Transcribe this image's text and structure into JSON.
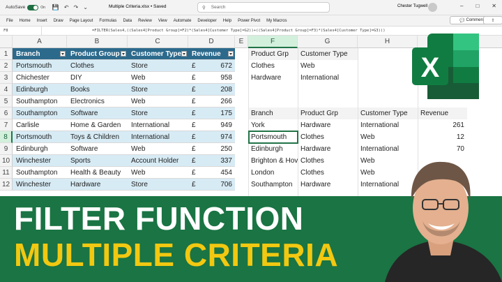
{
  "titlebar": {
    "autosave_label": "AutoSave",
    "toggle_state": "On",
    "doc_title": "Multiple Criteria.xlsx • Saved",
    "search_placeholder": "Search",
    "user_name": "Chester Tugwell"
  },
  "ribbon": {
    "tabs": [
      "File",
      "Home",
      "Insert",
      "Draw",
      "Page Layout",
      "Formulas",
      "Data",
      "Review",
      "View",
      "Automate",
      "Developer",
      "Help",
      "Power Pivot",
      "My Macros"
    ],
    "comments_label": "Comments",
    "share_icon": "share-icon"
  },
  "formula_bar": {
    "name_box": "F8",
    "formula": "=FILTER(Sales4,((Sales4[Product Group]=F2)*(Sales4[Customer Type]=G2))+((Sales4[Product Group]=F3)*(Sales4[Customer Type]=G3)))"
  },
  "columns": [
    "A",
    "B",
    "C",
    "D",
    "E",
    "F",
    "G",
    "H"
  ],
  "rows": [
    "1",
    "2",
    "3",
    "4",
    "5",
    "6",
    "7",
    "8",
    "9",
    "10",
    "11",
    "12"
  ],
  "table": {
    "headers": [
      "Branch",
      "Product Group",
      "Customer Type",
      "Revenue"
    ],
    "currency": "£",
    "rows": [
      [
        "Portsmouth",
        "Clothes",
        "Store",
        "672"
      ],
      [
        "Chichester",
        "DIY",
        "Web",
        "958"
      ],
      [
        "Edinburgh",
        "Books",
        "Store",
        "208"
      ],
      [
        "Southampton",
        "Electronics",
        "Web",
        "266"
      ],
      [
        "Southampton",
        "Software",
        "Store",
        "175"
      ],
      [
        "Carlisle",
        "Home & Garden",
        "International",
        "949"
      ],
      [
        "Portsmouth",
        "Toys & Children",
        "International",
        "974"
      ],
      [
        "Edinburgh",
        "Software",
        "Web",
        "250"
      ],
      [
        "Winchester",
        "Sports",
        "Account Holder",
        "337"
      ],
      [
        "Southampton",
        "Health & Beauty",
        "Web",
        "454"
      ],
      [
        "Winchester",
        "Hardware",
        "Store",
        "706"
      ]
    ]
  },
  "criteria": {
    "headers": [
      "Product Grp",
      "Customer Type"
    ],
    "rows": [
      [
        "Clothes",
        "Web"
      ],
      [
        "Hardware",
        "International"
      ]
    ]
  },
  "results": {
    "headers": [
      "Branch",
      "Product Grp",
      "Customer Type",
      "Revenue"
    ],
    "rows": [
      [
        "York",
        "Hardware",
        "International",
        "261"
      ],
      [
        "Portsmouth",
        "Clothes",
        "Web",
        "12"
      ],
      [
        "Edinburgh",
        "Hardware",
        "International",
        "70"
      ],
      [
        "Brighton & Hove",
        "Clothes",
        "Web",
        ""
      ],
      [
        "London",
        "Clothes",
        "Web",
        ""
      ],
      [
        "Southampton",
        "Hardware",
        "International",
        ""
      ]
    ]
  },
  "logo_letter": "X",
  "banner": {
    "line1": "FILTER FUNCTION",
    "line2": "MULTIPLE CRITERIA",
    "line1_color": "#ffffff",
    "line2_color": "#f2c811",
    "background": "#1a7443"
  }
}
